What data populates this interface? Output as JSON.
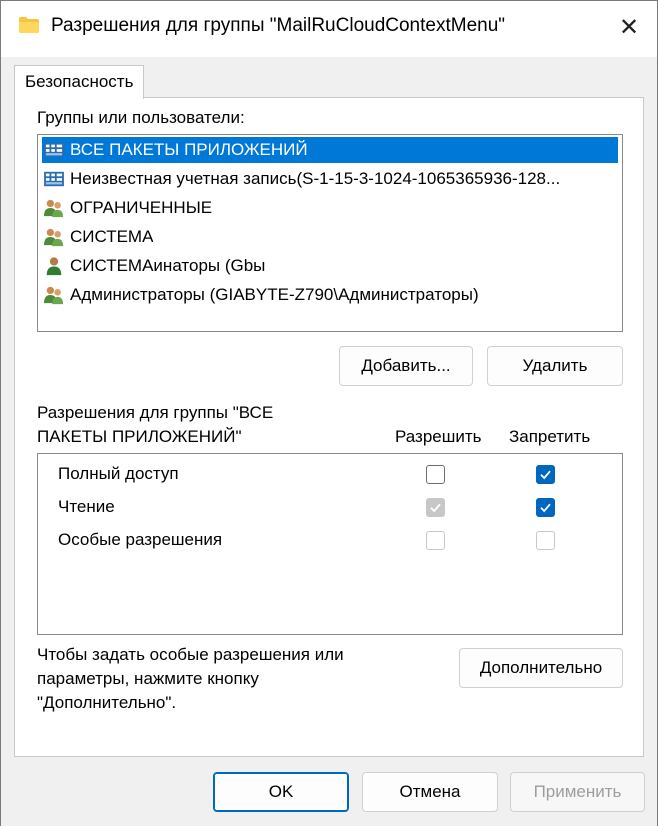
{
  "window": {
    "title": "Разрешения для группы \"MailRuCloudContextMenu\"",
    "close_glyph": "✕"
  },
  "tab": {
    "label": "Безопасность"
  },
  "groups": {
    "label": "Группы или пользователи:",
    "items": [
      {
        "label": "ВСЕ ПАКЕТЫ ПРИЛОЖЕНИЙ",
        "icon": "app-packages-icon",
        "selected": true
      },
      {
        "label": "Неизвестная учетная запись(S-1-15-3-1024-1065365936-128...",
        "icon": "app-packages-icon",
        "selected": false
      },
      {
        "label": "ОГРАНИЧЕННЫЕ",
        "icon": "users-group-icon",
        "selected": false
      },
      {
        "label": "СИСТЕМА",
        "icon": "users-group-icon",
        "selected": false
      },
      {
        "label": "СИСТЕМАинаторы (Gbы",
        "icon": "user-icon",
        "selected": false
      },
      {
        "label": "Администраторы (GIABYTE-Z790\\Администраторы)",
        "icon": "users-group-icon",
        "selected": false
      }
    ],
    "add_button": "Добавить...",
    "remove_button": "Удалить"
  },
  "permissions": {
    "label_line1": "Разрешения для группы \"ВСЕ",
    "label_line2": "ПАКЕТЫ ПРИЛОЖЕНИЙ\"",
    "allow_header": "Разрешить",
    "deny_header": "Запретить",
    "rows": [
      {
        "name": "Полный доступ",
        "allow": "unchecked",
        "deny": "checked"
      },
      {
        "name": "Чтение",
        "allow": "checked-disabled",
        "deny": "checked"
      },
      {
        "name": "Особые разрешения",
        "allow": "disabled",
        "deny": "disabled"
      }
    ]
  },
  "advanced": {
    "text_line1": "Чтобы задать особые разрешения или",
    "text_line2": "параметры, нажмите кнопку",
    "text_line3": "\"Дополнительно\".",
    "button": "Дополнительно"
  },
  "footer": {
    "ok": "OK",
    "cancel": "Отмена",
    "apply": "Применить"
  },
  "colors": {
    "accent": "#0067c0",
    "selection": "#0078d7"
  }
}
